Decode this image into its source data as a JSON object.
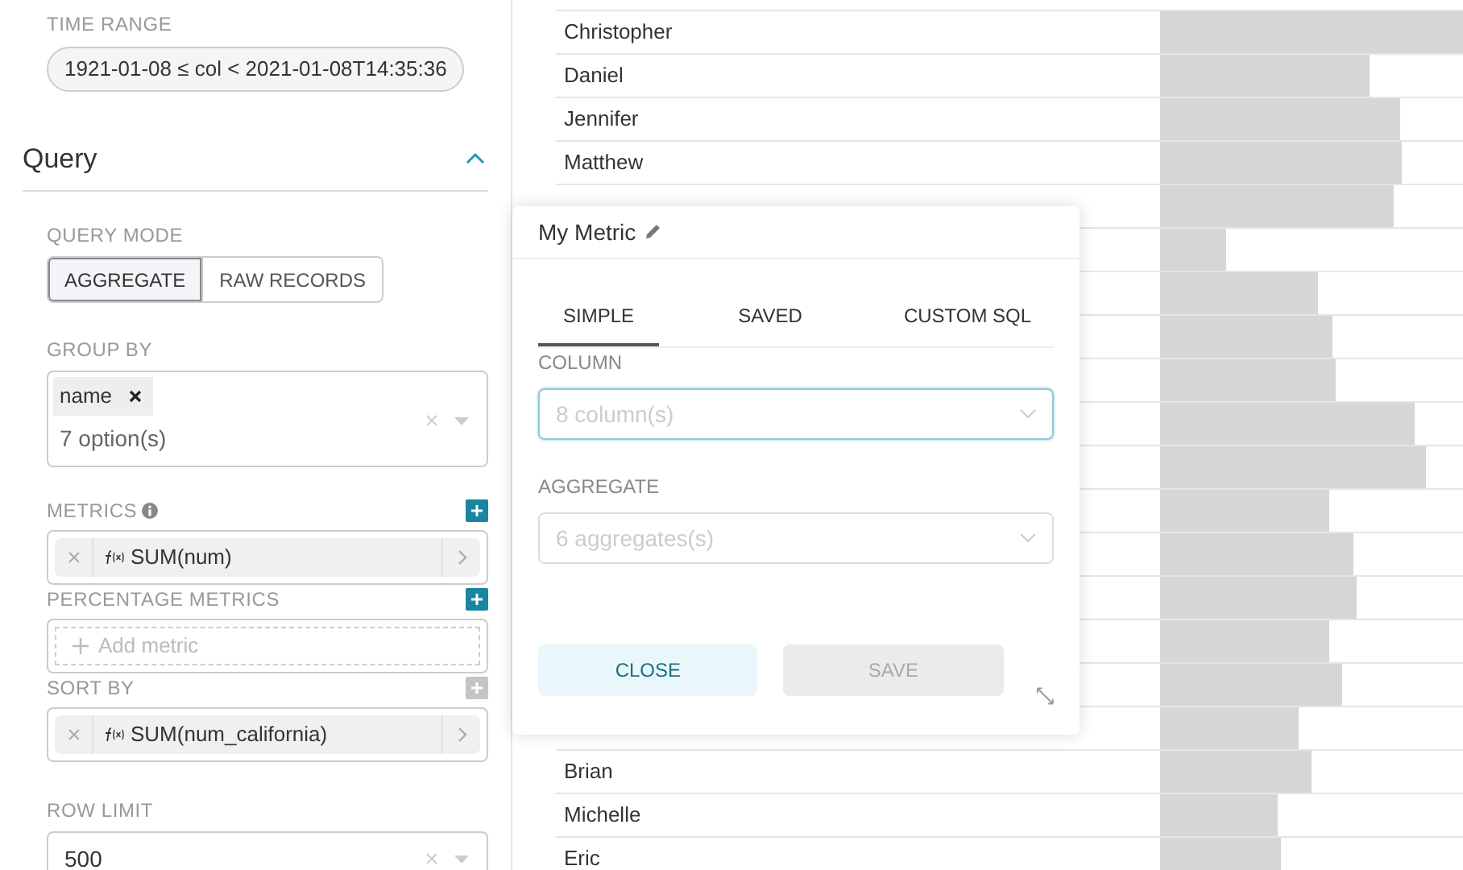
{
  "time_range": {
    "label": "TIME RANGE",
    "value": "1921-01-08 ≤ col < 2021-01-08T14:35:36"
  },
  "query": {
    "title": "Query",
    "expanded": true,
    "query_mode": {
      "label": "QUERY MODE",
      "options": [
        {
          "label": "AGGREGATE",
          "selected": true
        },
        {
          "label": "RAW RECORDS",
          "selected": false
        }
      ]
    },
    "group_by": {
      "label": "GROUP BY",
      "tags": [
        "name"
      ],
      "placeholder": "7 option(s)"
    },
    "metrics": {
      "label": "METRICS",
      "add_disabled": false,
      "items": [
        "SUM(num)"
      ]
    },
    "percentage_metrics": {
      "label": "PERCENTAGE METRICS",
      "add_disabled": false,
      "placeholder": "Add metric"
    },
    "sort_by": {
      "label": "SORT BY",
      "add_disabled": true,
      "items": [
        "SUM(num_california)"
      ]
    },
    "row_limit": {
      "label": "ROW LIMIT",
      "value": "500"
    }
  },
  "table": {
    "rows": [
      {
        "name": "Christopher",
        "level": 1.0
      },
      {
        "name": "Daniel",
        "level": 0.69
      },
      {
        "name": "Jennifer",
        "level": 0.79
      },
      {
        "name": "Matthew",
        "level": 0.8
      },
      {
        "level": 0.77
      },
      {
        "level": 0.22
      },
      {
        "level": 0.52
      },
      {
        "level": 0.57
      },
      {
        "level": 0.58
      },
      {
        "level": 0.84
      },
      {
        "level": 0.88
      },
      {
        "level": 0.56
      },
      {
        "level": 0.64
      },
      {
        "level": 0.65
      },
      {
        "level": 0.56
      },
      {
        "level": 0.6
      },
      {
        "level": 0.46
      },
      {
        "name": "Brian",
        "level": 0.5
      },
      {
        "name": "Michelle",
        "level": 0.39
      },
      {
        "name": "Eric",
        "level": 0.4
      }
    ]
  },
  "popover": {
    "title": "My Metric",
    "tabs": [
      {
        "label": "SIMPLE",
        "selected": true
      },
      {
        "label": "SAVED",
        "selected": false
      },
      {
        "label": "CUSTOM SQL",
        "selected": false
      }
    ],
    "column": {
      "label": "COLUMN",
      "placeholder": "8 column(s)",
      "focused": true
    },
    "aggregate": {
      "label": "AGGREGATE",
      "placeholder": "6 aggregates(s)",
      "focused": false
    },
    "close": {
      "label": "CLOSE"
    },
    "save": {
      "label": "SAVE",
      "disabled": true
    }
  }
}
